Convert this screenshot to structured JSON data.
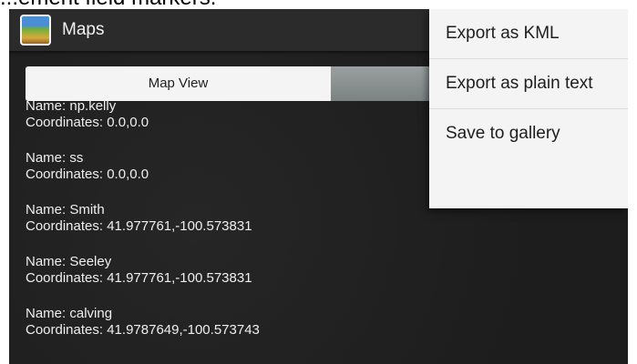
{
  "caption": "...ement field markers.",
  "app_bar": {
    "title": "Maps",
    "icon": "app-landscape-icon",
    "overflow_icon": "overflow-menu-icon"
  },
  "tabs": [
    {
      "label": "Map View",
      "selected": false
    },
    {
      "label": "",
      "selected": true
    }
  ],
  "points": [
    {
      "name": "Name:  np.kelly",
      "coordinates": "Coordinates: 0.0,0.0"
    },
    {
      "name": "Name: ss",
      "coordinates": "Coordinates: 0.0,0.0"
    },
    {
      "name": "Name: Smith",
      "coordinates": "Coordinates: 41.977761,-100.573831"
    },
    {
      "name": "Name: Seeley",
      "coordinates": "Coordinates: 41.977761,-100.573831"
    },
    {
      "name": "Name: calving",
      "coordinates": "Coordinates: 41.9787649,-100.573743"
    }
  ],
  "menu": {
    "items": [
      {
        "label": "Export as KML"
      },
      {
        "label": "Export as plain text"
      },
      {
        "label": "Save to gallery"
      }
    ]
  },
  "colors": {
    "background": "#202020",
    "app_bar": "#2b2b2b",
    "menu_background": "#f4f4f4",
    "text_light": "#efefef"
  }
}
